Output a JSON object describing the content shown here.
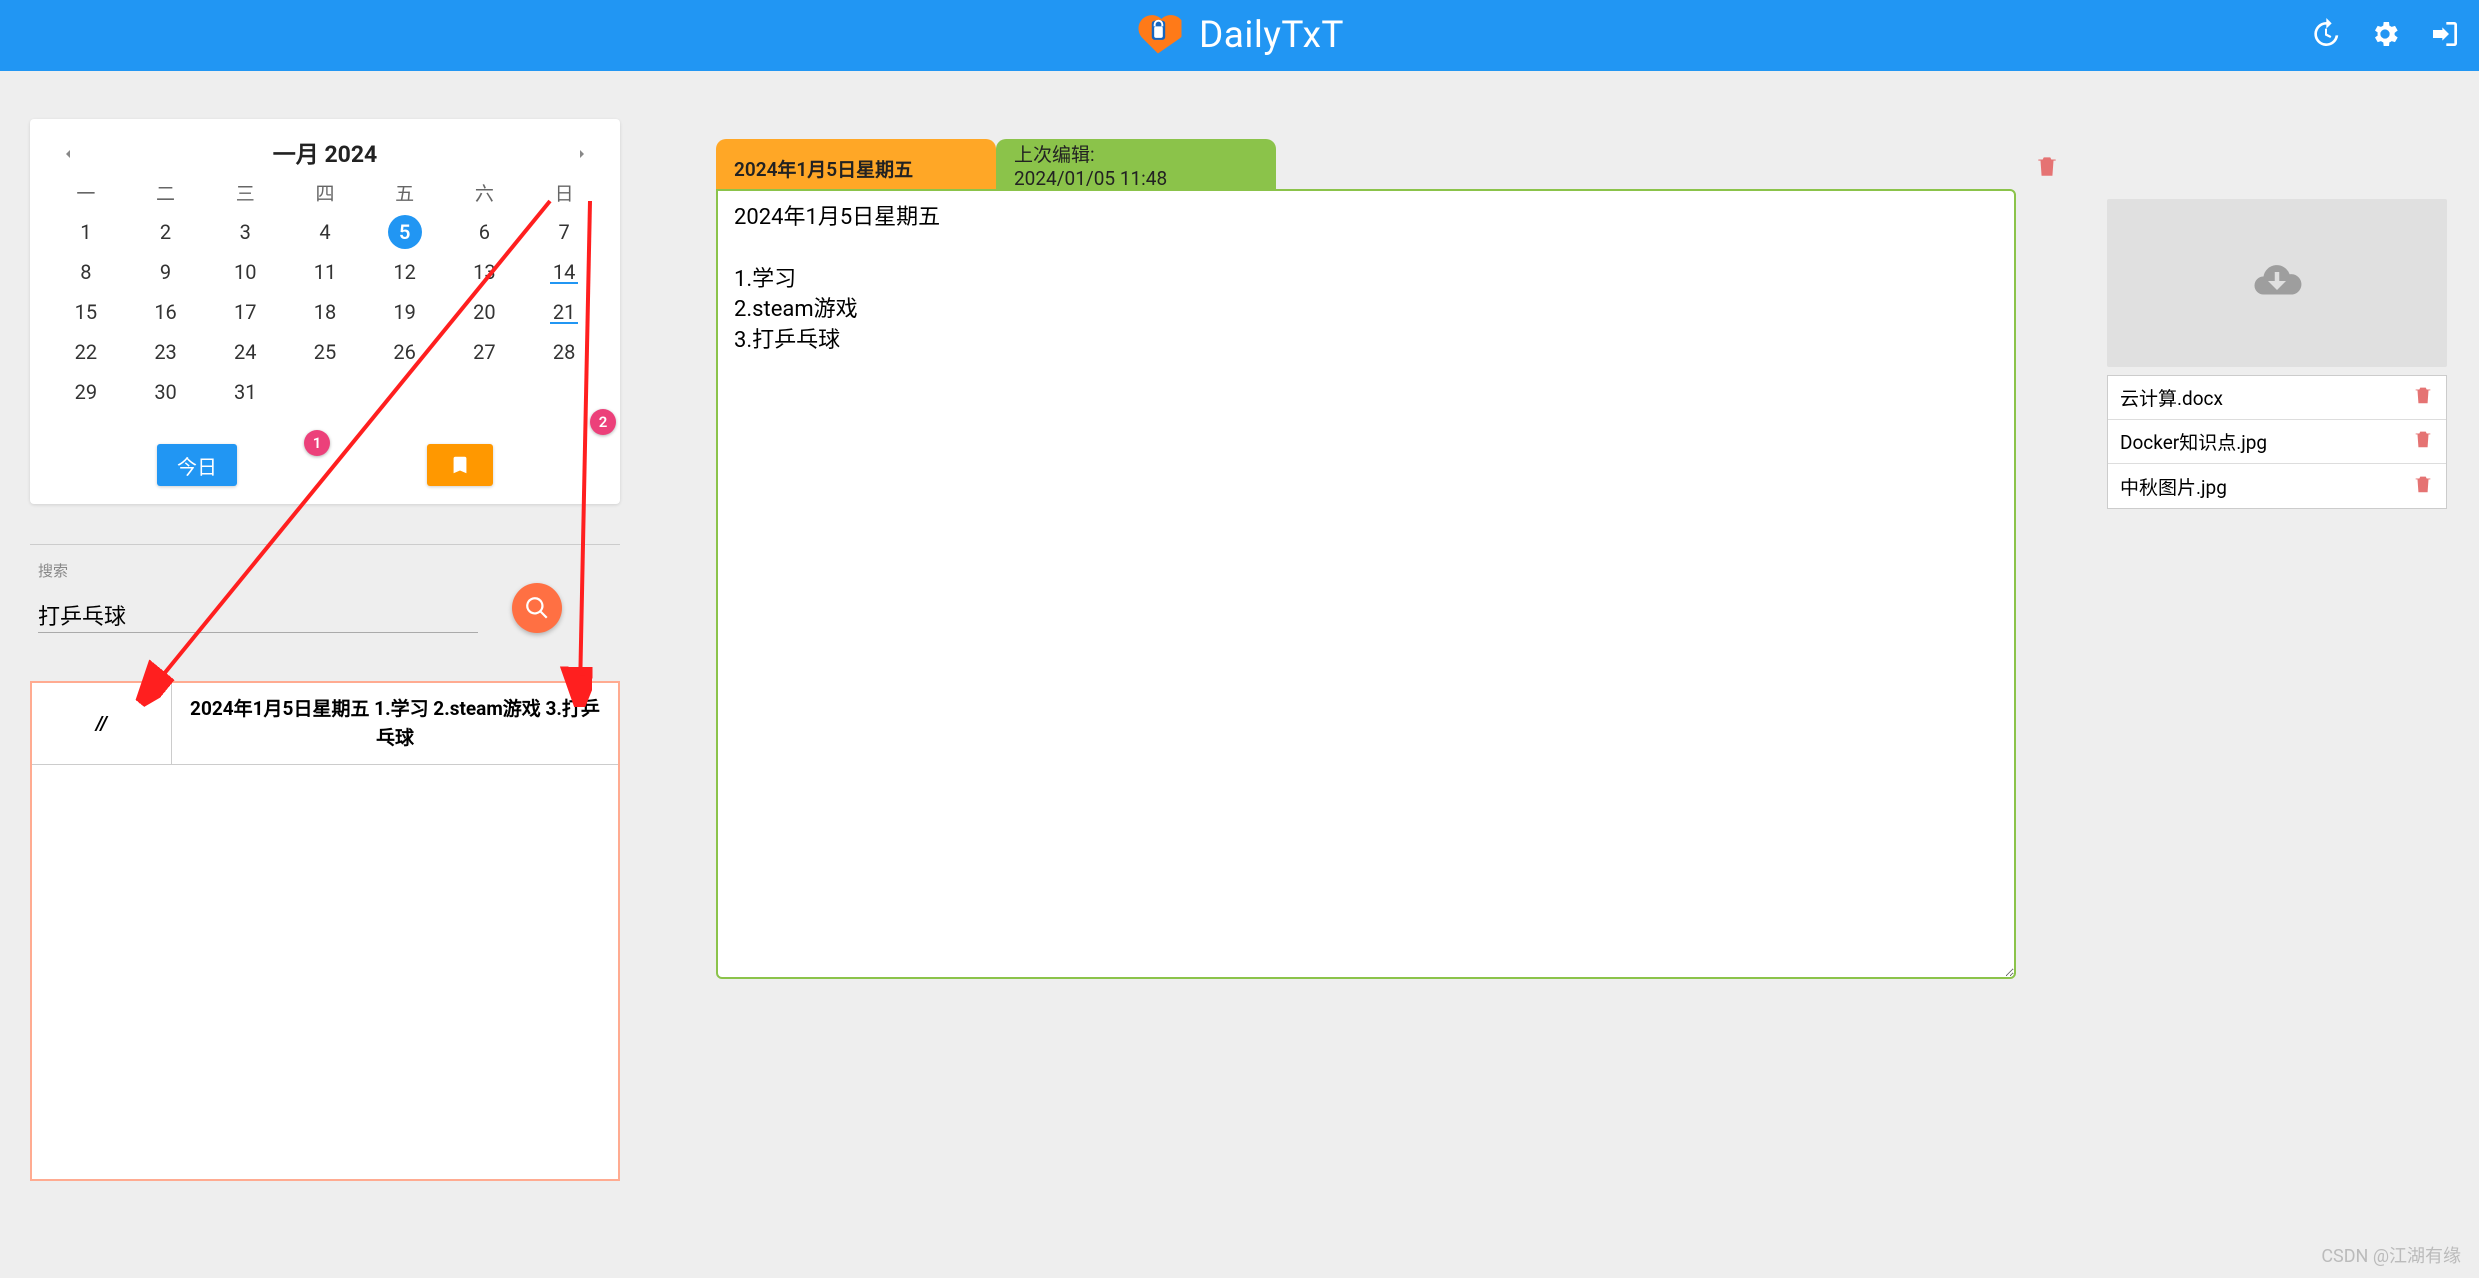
{
  "header": {
    "app_name": "DailyTxT"
  },
  "calendar": {
    "title": "一月 2024",
    "weekdays": [
      "一",
      "二",
      "三",
      "四",
      "五",
      "六",
      "日"
    ],
    "weeks": [
      [
        1,
        2,
        3,
        4,
        5,
        6,
        7
      ],
      [
        8,
        9,
        10,
        11,
        12,
        13,
        14
      ],
      [
        15,
        16,
        17,
        18,
        19,
        20,
        21
      ],
      [
        22,
        23,
        24,
        25,
        26,
        27,
        28
      ],
      [
        29,
        30,
        31,
        null,
        null,
        null,
        null
      ]
    ],
    "selected": 5,
    "marked": [
      5,
      14,
      21
    ],
    "today_btn": "今日",
    "badge1": "1",
    "badge2": "2"
  },
  "search": {
    "label": "搜索",
    "value": "打乒乓球"
  },
  "search_result": {
    "date_col": "//",
    "text": "2024年1月5日星期五 1.学习 2.steam游戏 3.打乒乓球"
  },
  "entry": {
    "tab_date": "2024年1月5日星期五",
    "tab_edit_label": "上次编辑:",
    "tab_edit_time": "2024/01/05 11:48",
    "body": "2024年1月5日星期五\n\n1.学习\n2.steam游戏\n3.打乒乓球"
  },
  "files": [
    "云计算.docx",
    "Docker知识点.jpg",
    "中秋图片.jpg"
  ],
  "watermark": "CSDN @江湖有缘"
}
